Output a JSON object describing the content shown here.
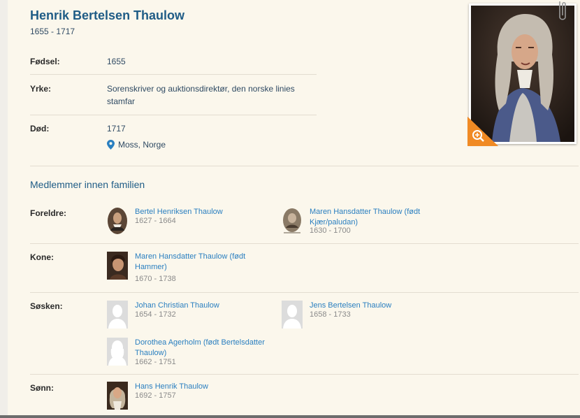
{
  "profile": {
    "name": "Henrik Bertelsen Thaulow",
    "lifespan": "1655 - 1717",
    "facts": [
      {
        "label": "Fødsel:",
        "value": "1655"
      },
      {
        "label": "Yrke:",
        "value": "Sorenskriver og auktionsdirektør, den norske linies stamfar"
      },
      {
        "label": "Død:",
        "value": "1717"
      }
    ],
    "death_place": "Moss, Norge",
    "icons": {
      "location": "location-pin-icon",
      "zoom": "zoom-in-icon",
      "clip": "paperclip-icon"
    }
  },
  "family": {
    "section_title": "Medlemmer innen familien",
    "groups": [
      {
        "label": "Foreldre:",
        "people": [
          {
            "name": "Bertel Henriksen Thaulow",
            "dates": "1627 - 1664"
          },
          {
            "name": "Maren Hansdatter Thaulow (født Kjær/paludan)",
            "dates": "1630 - 1700"
          }
        ]
      },
      {
        "label": "Kone:",
        "people": [
          {
            "name": "Maren Hansdatter Thaulow (født Hammer)",
            "dates": "1670 - 1738"
          }
        ]
      },
      {
        "label": "Søsken:",
        "people": [
          {
            "name": "Johan Christian Thaulow",
            "dates": "1654 - 1732"
          },
          {
            "name": "Jens Bertelsen Thaulow",
            "dates": "1658 - 1733"
          },
          {
            "name": "Dorothea Agerholm (født Bertelsdatter Thaulow)",
            "dates": "1662 - 1751"
          }
        ]
      },
      {
        "label": "Sønn:",
        "people": [
          {
            "name": "Hans Henrik Thaulow",
            "dates": "1692 - 1757"
          }
        ]
      }
    ]
  },
  "colors": {
    "accent": "#1f5c86",
    "link": "#2a7fc0",
    "zoom": "#f08a24",
    "background": "#fbf7ec"
  }
}
